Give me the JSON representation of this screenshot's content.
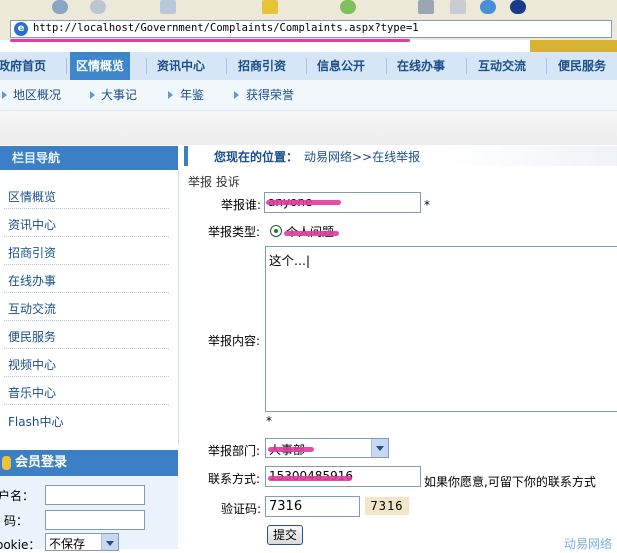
{
  "browser": {
    "url": "http://localhost/Government/Complaints/Complaints.aspx?type=1"
  },
  "nav": {
    "items": [
      "政府首页",
      "区情概览",
      "资讯中心",
      "招商引资",
      "信息公开",
      "在线办事",
      "互动交流",
      "便民服务"
    ],
    "active_index": 1
  },
  "subnav": {
    "items": [
      "地区概况",
      "大事记",
      "年鉴",
      "获得荣誉"
    ]
  },
  "sidebar": {
    "title": "栏目导航",
    "items": [
      "区情概览",
      "资讯中心",
      "招商引资",
      "在线办事",
      "互动交流",
      "便民服务",
      "视频中心",
      "音乐中心",
      "Flash中心"
    ]
  },
  "login": {
    "title": "会员登录",
    "username_label": "户名：",
    "password_label": "码：",
    "cookie_label": "ookie：",
    "cookie_value": "不保存"
  },
  "location": {
    "prefix": "您现在的位置：",
    "path": "动易网络>>在线举报"
  },
  "tabs": "举报 投诉",
  "form": {
    "reporter_label": "举报谁:",
    "reporter_value": "anyone",
    "type_label": "举报类型:",
    "type_option": "个人问题",
    "content_label": "举报内容:",
    "content_value": "这个...|",
    "department_label": "举报部门:",
    "department_value": "人事部",
    "contact_label": "联系方式:",
    "contact_value": "15300485916",
    "contact_hint": "如果你愿意,可留下你的联系方式",
    "captcha_label": "验证码:",
    "captcha_value": "7316",
    "captcha_image": "7316",
    "required_mark": "*",
    "submit": "提交"
  },
  "footer": {
    "brand": "动易网络"
  },
  "colors": {
    "nav_bg": "#d6e6f6",
    "nav_active": "#3d86cc",
    "sidebar_head": "#3c7fc4",
    "link": "#1a4f8a",
    "redaction": "#e0389e"
  }
}
